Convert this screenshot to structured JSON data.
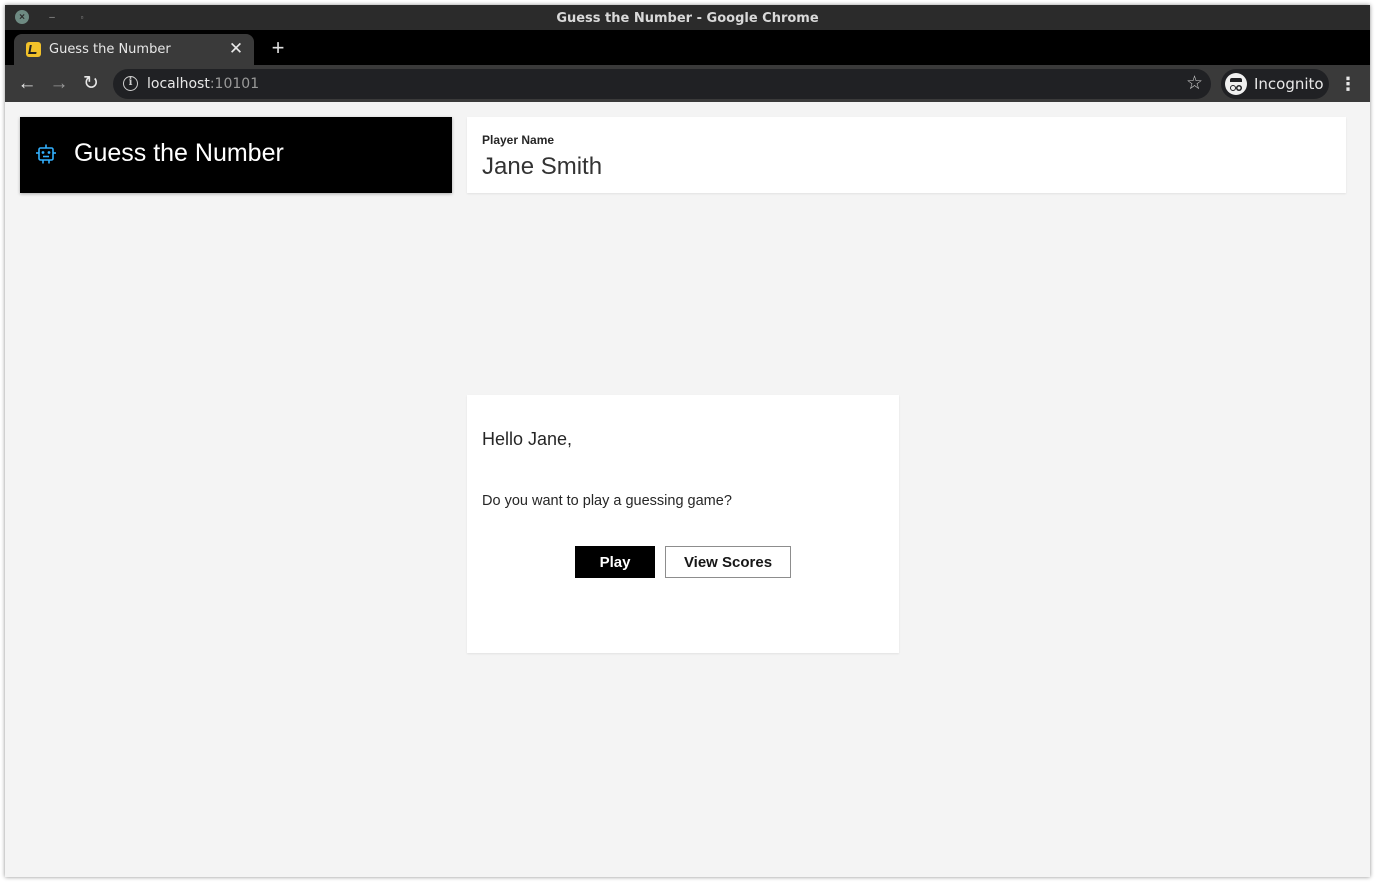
{
  "window": {
    "title": "Guess the Number - Google Chrome",
    "controls": {
      "close": "×",
      "minimize": "–",
      "maximize": "▫"
    }
  },
  "tabs": [
    {
      "title": "Guess the Number",
      "close": "✕"
    }
  ],
  "new_tab": "+",
  "toolbar": {
    "back": "←",
    "forward": "→",
    "reload": "↻",
    "info": "i",
    "url_host": "localhost",
    "url_port": ":10101",
    "star": "☆",
    "incognito_label": "Incognito",
    "menu": "⋮"
  },
  "app": {
    "title": "Guess the Number",
    "icon": "bot-icon",
    "accent_color": "#33b1ff"
  },
  "player": {
    "label": "Player Name",
    "name": "Jane Smith"
  },
  "game": {
    "greeting": "Hello Jane,",
    "question": "Do you want to play a guessing game?",
    "play_label": "Play",
    "scores_label": "View Scores"
  }
}
